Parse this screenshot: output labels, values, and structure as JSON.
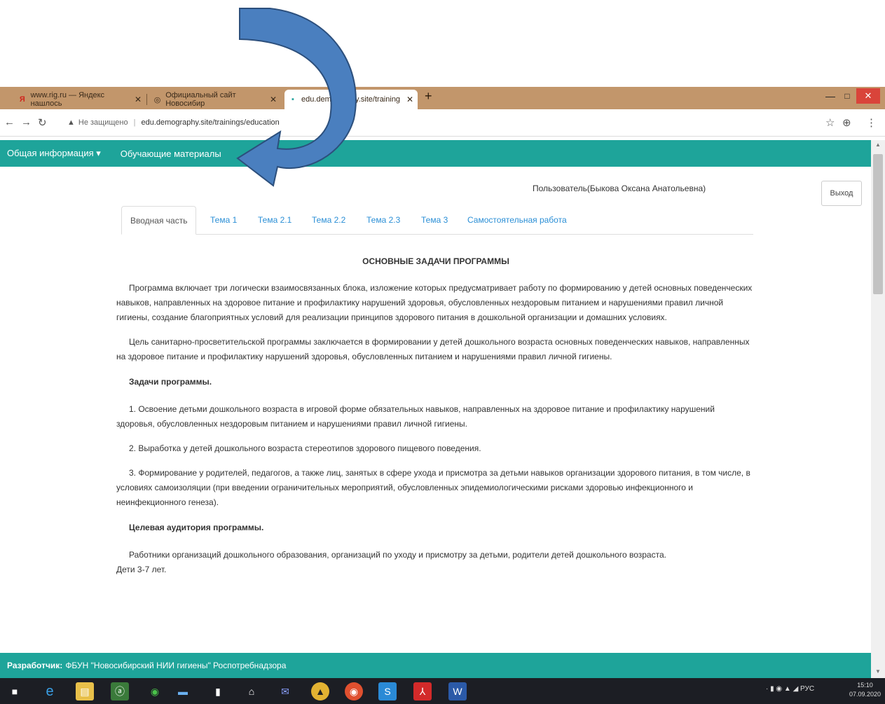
{
  "browser": {
    "tabs": [
      {
        "label": "www.rig.ru — Яндекс нашлось",
        "icon": "yandex-icon"
      },
      {
        "label": "Официальный сайт Новосибир",
        "icon": "globe-icon"
      },
      {
        "label": "edu.demography.site/training",
        "icon": "site-favicon-icon"
      }
    ],
    "new_tab": "+",
    "window_controls": {
      "minimize": "—",
      "maximize": "□",
      "close": "✕"
    },
    "address": {
      "security": "Не защищено",
      "url": "edu.demography.site/trainings/education"
    }
  },
  "site_nav": {
    "items": [
      "Общая информация ▾",
      "Обучающие материалы"
    ]
  },
  "header": {
    "user": "Пользователь(Быкова Оксана Анатольевна)",
    "logout": "Выход"
  },
  "content_tabs": [
    {
      "label": "Вводная часть",
      "active": true
    },
    {
      "label": "Тема 1"
    },
    {
      "label": "Тема 2.1"
    },
    {
      "label": "Тема 2.2"
    },
    {
      "label": "Тема 2.3"
    },
    {
      "label": "Тема 3"
    },
    {
      "label": "Самостоятельная работа"
    }
  ],
  "article": {
    "title": "ОСНОВНЫЕ ЗАДАЧИ ПРОГРАММЫ",
    "p1": "Программа включает три логически взаимосвязанных блока, изложение которых предусматривает работу по формированию у детей основных поведенческих навыков, направленных на здоровое питание и профилактику нарушений здоровья, обусловленных нездоровым питанием и нарушениями правил личной гигиены, создание благоприятных условий для реализации принципов здорового питания в дошкольной организации и домашних условиях.",
    "p2": "Цель санитарно-просветительской программы заключается в формировании у детей дошкольного возраста основных поведенческих навыков, направленных на здоровое питание и профилактику нарушений здоровья, обусловленных питанием и нарушениями правил личной гигиены.",
    "h1": "Задачи программы.",
    "t1": "1. Освоение детьми дошкольного возраста в игровой форме обязательных навыков, направленных на здоровое питание и профилактику нарушений здоровья, обусловленных нездоровым питанием и нарушениями правил личной гигиены.",
    "t2": "2. Выработка у детей дошкольного возраста стереотипов здорового пищевого поведения.",
    "t3": "3. Формирование у родителей, педагогов, а также лиц, занятых в сфере ухода и присмотра за детьми навыков организации здорового питания, в том числе, в условиях самоизоляции (при введении ограничительных мероприятий, обусловленных эпидемиологическими рисками здоровью инфекционного и неинфекционного генеза).",
    "h2": "Целевая аудитория программы.",
    "a1": "Работники организаций дошкольного образования, организаций по уходу и присмотру за детьми, родители детей дошкольного возраста.",
    "a2": "Дети 3-7 лет."
  },
  "footer": {
    "label": "Разработчик:",
    "text": "ФБУН \"Новосибирский НИИ гигиены\" Роспотребнадзора"
  },
  "taskbar": {
    "icons": [
      "windows-start-icon",
      "edge-icon",
      "file-explorer-icon",
      "store-icon",
      "torrent-icon",
      "computer-icon",
      "document-icon",
      "home-icon",
      "mail-icon",
      "app-icon",
      "chrome-icon",
      "skype-icon",
      "pdf-icon",
      "word-icon"
    ],
    "lang": "РУС",
    "time": "15:10",
    "date": "07.09.2020"
  },
  "colors": {
    "accent": "#1ea49a",
    "tabbar": "#c2966b",
    "arrow": "#4a7fbf"
  }
}
